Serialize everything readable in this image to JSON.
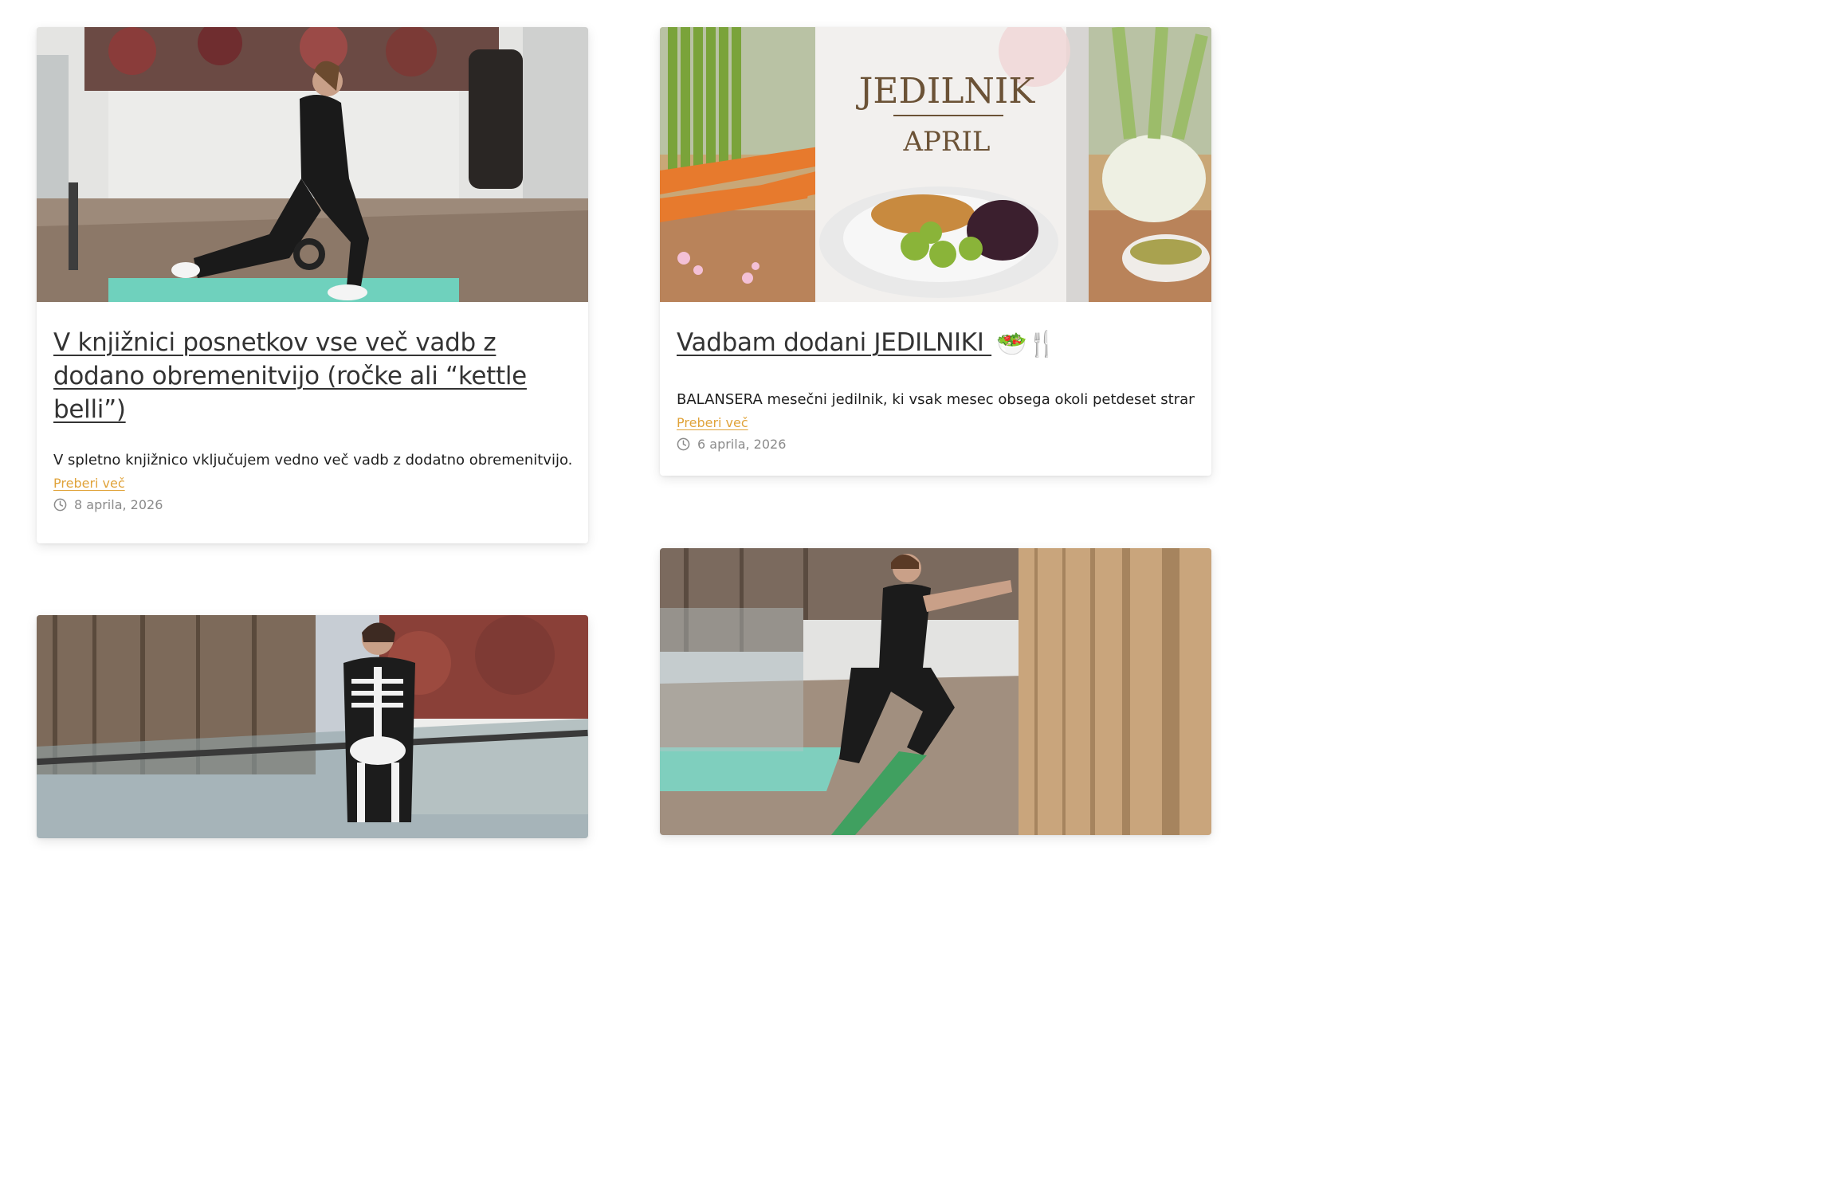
{
  "posts": [
    {
      "title": "V knjižnici posnetkov vse več vadb z dodano obremenitvijo (ročke ali “kettle belli”)",
      "excerpt": "V spletno knjižnico vključujem vedno več vadb z dodatno obremenitvijo...",
      "read_more": "Preberi več",
      "date": "8 aprila, 2026",
      "image_icon": "lunge-kettlebell-photo"
    },
    {
      "title": "Vadbam dodani JEDILNIKI ",
      "title_emoji": "🥗🍴",
      "excerpt": "BALANSERA mesečni jedilnik, ki vsak mesec obsega okoli petdeset strani...",
      "read_more": "Preberi več",
      "date": "6 aprila, 2026",
      "image_icon": "meal-plan-book-photo",
      "image_text": {
        "line1": "JEDILNIK",
        "line2": "APRIL"
      }
    },
    {
      "image_icon": "skeleton-costume-photo"
    },
    {
      "image_icon": "band-wall-stretch-photo"
    }
  ],
  "colors": {
    "title": "#333333",
    "read_more": "#e0a33a",
    "meta": "#8a8a8a",
    "excerpt": "#1e1e1e"
  }
}
